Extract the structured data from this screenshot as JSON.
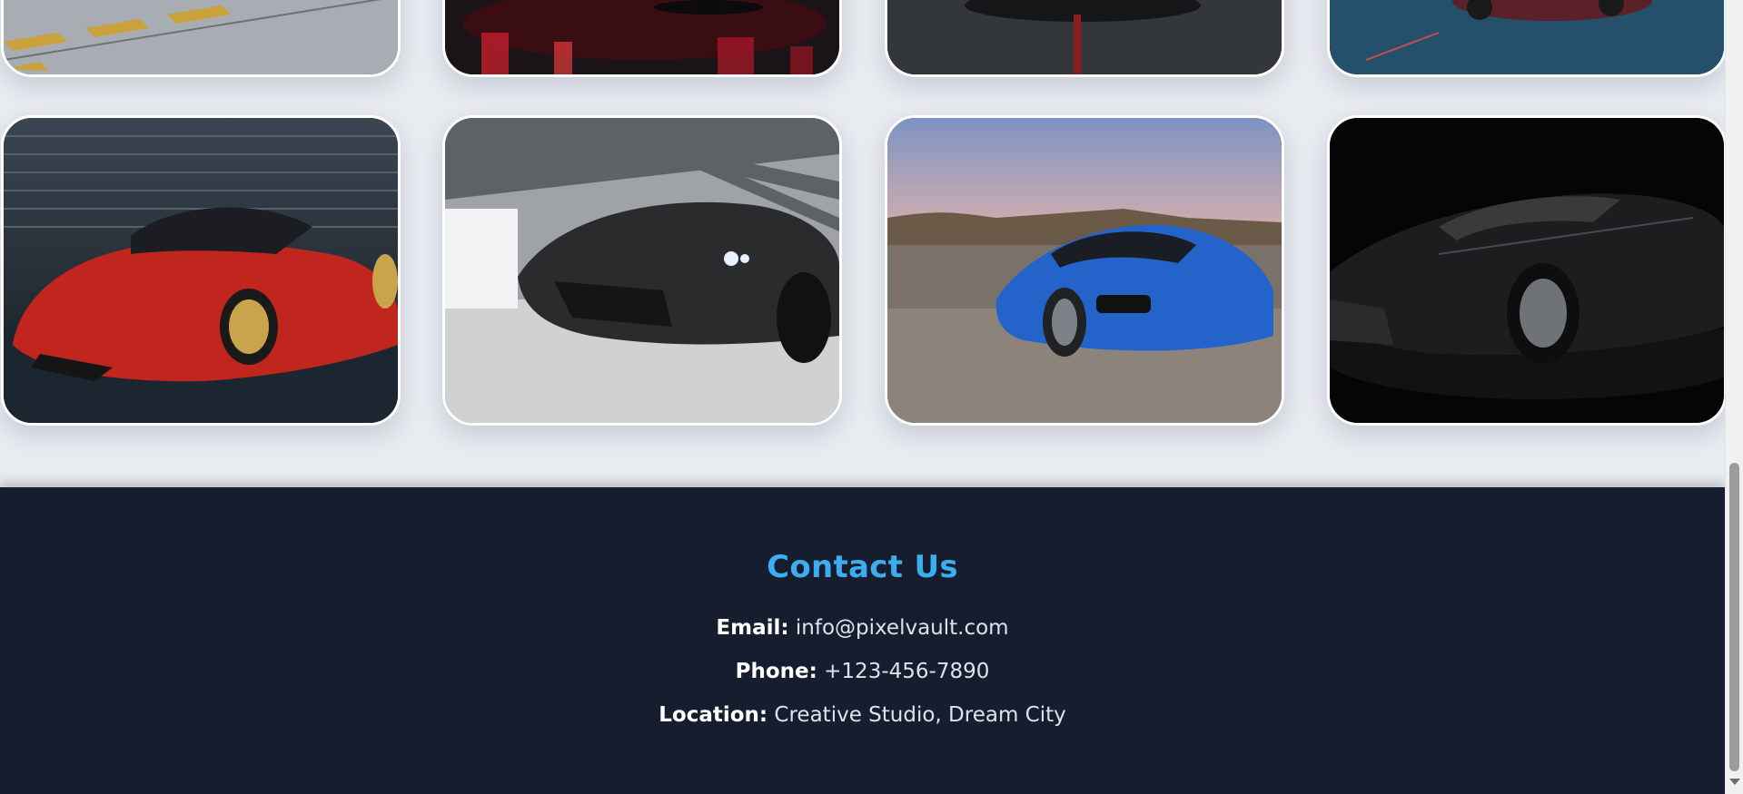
{
  "contact": {
    "title": "Contact Us",
    "email_label": "Email:",
    "email_value": "info@pixelvault.com",
    "phone_label": "Phone:",
    "phone_value": "+123-456-7890",
    "location_label": "Location:",
    "location_value": "Creative Studio, Dream City"
  },
  "colors": {
    "page_bg": "#e8ebf0",
    "footer_bg": "#161d2e",
    "accent": "#3aaef0",
    "text": "#dde3ec"
  },
  "gallery": {
    "top_row": [
      "garage-floor-car-photo",
      "red-lit-car-photo",
      "dark-supercar-photo",
      "red-car-night-lot-photo"
    ],
    "bottom_row": [
      "red-mclaren-photo",
      "black-lamborghini-photo",
      "blue-bmw-i8-photo",
      "black-bugatti-photo"
    ]
  }
}
